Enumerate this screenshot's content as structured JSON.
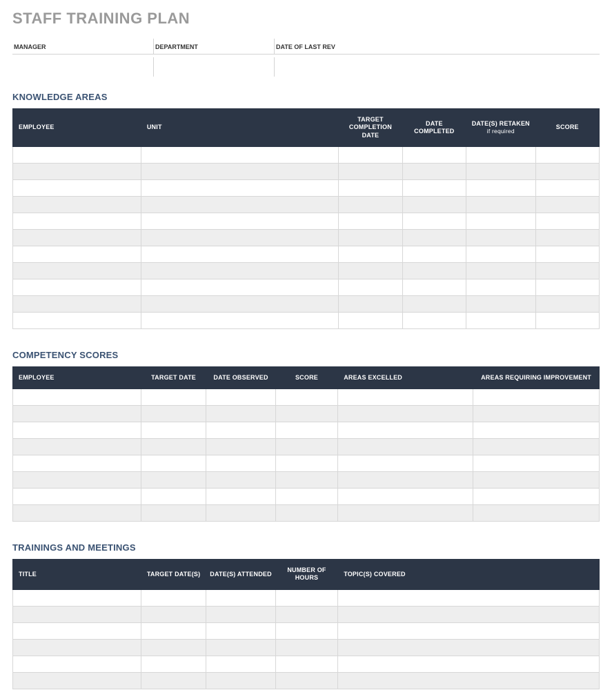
{
  "title": "STAFF TRAINING PLAN",
  "meta": {
    "manager_label": "MANAGER",
    "manager_value": "",
    "department_label": "DEPARTMENT",
    "department_value": "",
    "rev_label": "DATE OF LAST REV",
    "rev_value": ""
  },
  "sections": {
    "knowledge": {
      "title": "KNOWLEDGE AREAS",
      "headers": {
        "employee": "EMPLOYEE",
        "unit": "UNIT",
        "target_date": "TARGET COMPLETION DATE",
        "date_completed": "DATE COMPLETED",
        "retaken": "DATE(S) RETAKEN",
        "retaken_sub": "if required",
        "score": "SCORE"
      },
      "rows": [
        {
          "employee": "",
          "unit": "",
          "target_date": "",
          "date_completed": "",
          "retaken": "",
          "score": ""
        },
        {
          "employee": "",
          "unit": "",
          "target_date": "",
          "date_completed": "",
          "retaken": "",
          "score": ""
        },
        {
          "employee": "",
          "unit": "",
          "target_date": "",
          "date_completed": "",
          "retaken": "",
          "score": ""
        },
        {
          "employee": "",
          "unit": "",
          "target_date": "",
          "date_completed": "",
          "retaken": "",
          "score": ""
        },
        {
          "employee": "",
          "unit": "",
          "target_date": "",
          "date_completed": "",
          "retaken": "",
          "score": ""
        },
        {
          "employee": "",
          "unit": "",
          "target_date": "",
          "date_completed": "",
          "retaken": "",
          "score": ""
        },
        {
          "employee": "",
          "unit": "",
          "target_date": "",
          "date_completed": "",
          "retaken": "",
          "score": ""
        },
        {
          "employee": "",
          "unit": "",
          "target_date": "",
          "date_completed": "",
          "retaken": "",
          "score": ""
        },
        {
          "employee": "",
          "unit": "",
          "target_date": "",
          "date_completed": "",
          "retaken": "",
          "score": ""
        },
        {
          "employee": "",
          "unit": "",
          "target_date": "",
          "date_completed": "",
          "retaken": "",
          "score": ""
        },
        {
          "employee": "",
          "unit": "",
          "target_date": "",
          "date_completed": "",
          "retaken": "",
          "score": ""
        }
      ]
    },
    "competency": {
      "title": "COMPETENCY SCORES",
      "headers": {
        "employee": "EMPLOYEE",
        "target_date": "TARGET DATE",
        "date_observed": "DATE OBSERVED",
        "score": "SCORE",
        "excelled": "AREAS EXCELLED",
        "improve": "AREAS REQUIRING IMPROVEMENT"
      },
      "rows": [
        {
          "employee": "",
          "target_date": "",
          "date_observed": "",
          "score": "",
          "excelled": "",
          "improve": ""
        },
        {
          "employee": "",
          "target_date": "",
          "date_observed": "",
          "score": "",
          "excelled": "",
          "improve": ""
        },
        {
          "employee": "",
          "target_date": "",
          "date_observed": "",
          "score": "",
          "excelled": "",
          "improve": ""
        },
        {
          "employee": "",
          "target_date": "",
          "date_observed": "",
          "score": "",
          "excelled": "",
          "improve": ""
        },
        {
          "employee": "",
          "target_date": "",
          "date_observed": "",
          "score": "",
          "excelled": "",
          "improve": ""
        },
        {
          "employee": "",
          "target_date": "",
          "date_observed": "",
          "score": "",
          "excelled": "",
          "improve": ""
        },
        {
          "employee": "",
          "target_date": "",
          "date_observed": "",
          "score": "",
          "excelled": "",
          "improve": ""
        },
        {
          "employee": "",
          "target_date": "",
          "date_observed": "",
          "score": "",
          "excelled": "",
          "improve": ""
        }
      ]
    },
    "trainings": {
      "title": "TRAININGS AND MEETINGS",
      "headers": {
        "title": "TITLE",
        "target_dates": "TARGET DATE(S)",
        "dates_attended": "DATE(S) ATTENDED",
        "hours": "NUMBER OF HOURS",
        "topics": "TOPIC(S) COVERED"
      },
      "rows": [
        {
          "title": "",
          "target_dates": "",
          "dates_attended": "",
          "hours": "",
          "topics": ""
        },
        {
          "title": "",
          "target_dates": "",
          "dates_attended": "",
          "hours": "",
          "topics": ""
        },
        {
          "title": "",
          "target_dates": "",
          "dates_attended": "",
          "hours": "",
          "topics": ""
        },
        {
          "title": "",
          "target_dates": "",
          "dates_attended": "",
          "hours": "",
          "topics": ""
        },
        {
          "title": "",
          "target_dates": "",
          "dates_attended": "",
          "hours": "",
          "topics": ""
        },
        {
          "title": "",
          "target_dates": "",
          "dates_attended": "",
          "hours": "",
          "topics": ""
        }
      ]
    }
  }
}
